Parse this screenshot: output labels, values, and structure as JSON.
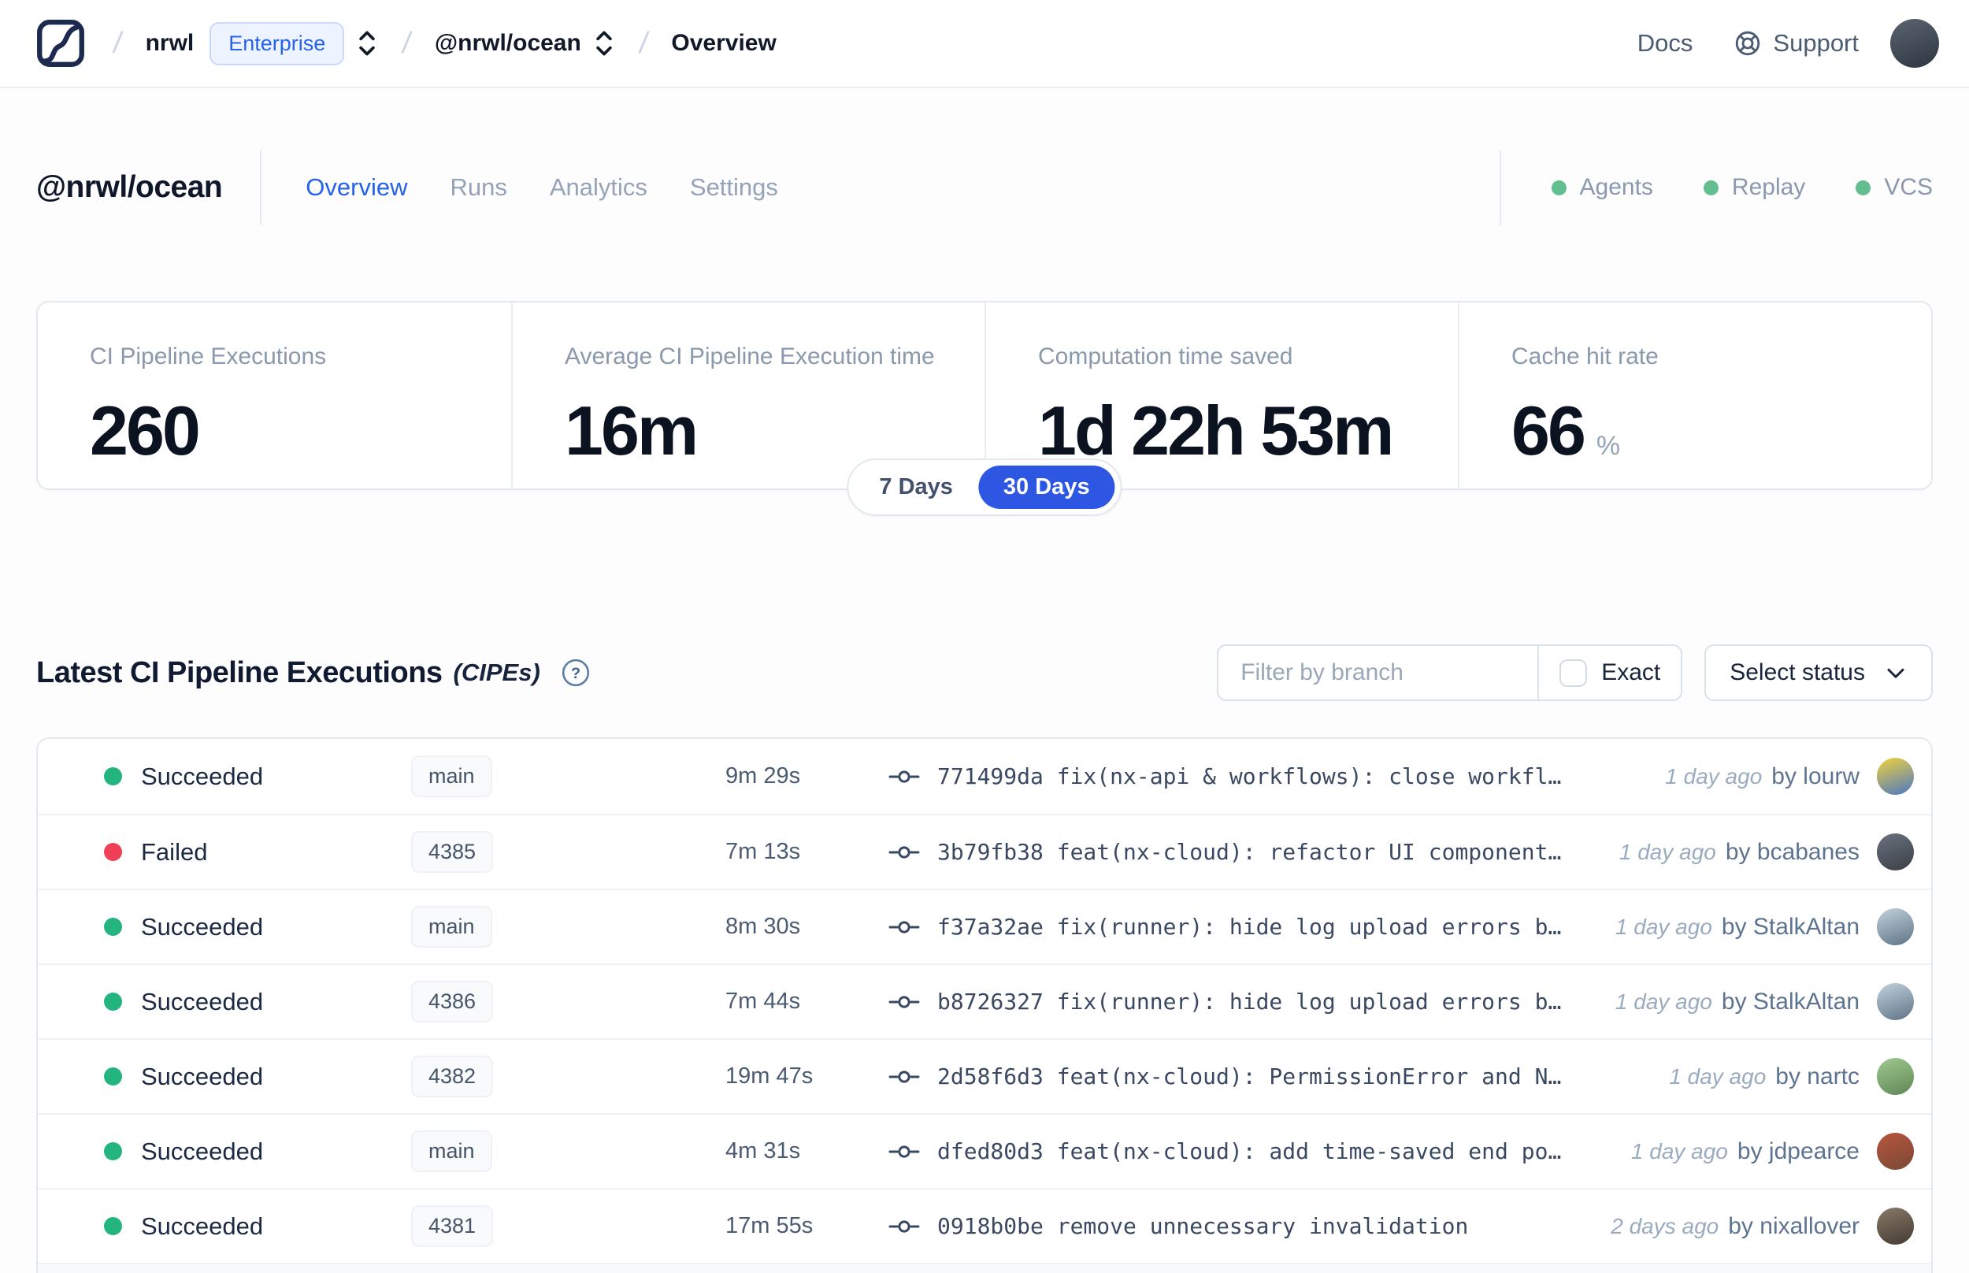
{
  "navbar": {
    "logo": "nx-cloud-logo",
    "breadcrumb": {
      "separator": "/",
      "org": "nrwl",
      "org_badge": "Enterprise",
      "workspace": "@nrwl/ocean",
      "page": "Overview"
    },
    "docs_label": "Docs",
    "support_label": "Support",
    "avatar_colors": [
      "#5a6470",
      "#2e3640"
    ]
  },
  "workspace_header": {
    "title": "@nrwl/ocean",
    "tabs": [
      {
        "label": "Overview",
        "active": true
      },
      {
        "label": "Runs",
        "active": false
      },
      {
        "label": "Analytics",
        "active": false
      },
      {
        "label": "Settings",
        "active": false
      }
    ],
    "status_indicators": [
      {
        "label": "Agents",
        "color": "#62be8e"
      },
      {
        "label": "Replay",
        "color": "#62be8e"
      },
      {
        "label": "VCS",
        "color": "#62be8e"
      }
    ]
  },
  "stats": {
    "cards": [
      {
        "label": "CI Pipeline Executions",
        "value": "260",
        "suffix": ""
      },
      {
        "label": "Average CI Pipeline Execution time",
        "value": "16m",
        "suffix": ""
      },
      {
        "label": "Computation time saved",
        "value": "1d 22h 53m",
        "suffix": ""
      },
      {
        "label": "Cache hit rate",
        "value": "66",
        "suffix": "%"
      }
    ]
  },
  "time_toggle": {
    "accent": "#2d57e2",
    "options": [
      {
        "label": "7 Days",
        "selected": false
      },
      {
        "label": "30 Days",
        "selected": true
      }
    ]
  },
  "cipe": {
    "title": "Latest CI Pipeline Executions",
    "title_suffix": "(CIPEs)",
    "filter": {
      "placeholder": "Filter by branch",
      "exact_label": "Exact",
      "exact_checked": false
    },
    "status_select_label": "Select status",
    "rows": [
      {
        "status": "Succeeded",
        "status_color": "#24b47e",
        "branch": "main",
        "duration": "9m 29s",
        "commit_hash": "771499da",
        "commit_message": "fix(nx-api & workflows): close workfl…",
        "time_ago": "1 day ago",
        "author": "by lourw",
        "avatar_colors": [
          "#f2d23d",
          "#4a77c4"
        ]
      },
      {
        "status": "Failed",
        "status_color": "#ee4056",
        "branch": "4385",
        "duration": "7m 13s",
        "commit_hash": "3b79fb38",
        "commit_message": "feat(nx-cloud): refactor UI component…",
        "time_ago": "1 day ago",
        "author": "by bcabanes",
        "avatar_colors": [
          "#6b7280",
          "#3a3f46"
        ]
      },
      {
        "status": "Succeeded",
        "status_color": "#24b47e",
        "branch": "main",
        "duration": "8m 30s",
        "commit_hash": "f37a32ae",
        "commit_message": "fix(runner): hide log upload errors b…",
        "time_ago": "1 day ago",
        "author": "by StalkAltan",
        "avatar_colors": [
          "#c3d2dc",
          "#5d7486"
        ]
      },
      {
        "status": "Succeeded",
        "status_color": "#24b47e",
        "branch": "4386",
        "duration": "7m 44s",
        "commit_hash": "b8726327",
        "commit_message": "fix(runner): hide log upload errors b…",
        "time_ago": "1 day ago",
        "author": "by StalkAltan",
        "avatar_colors": [
          "#c3d2dc",
          "#5d7486"
        ]
      },
      {
        "status": "Succeeded",
        "status_color": "#24b47e",
        "branch": "4382",
        "duration": "19m 47s",
        "commit_hash": "2d58f6d3",
        "commit_message": "feat(nx-cloud): PermissionError and N…",
        "time_ago": "1 day ago",
        "author": "by nartc",
        "avatar_colors": [
          "#9fc98e",
          "#5f8757"
        ]
      },
      {
        "status": "Succeeded",
        "status_color": "#24b47e",
        "branch": "main",
        "duration": "4m 31s",
        "commit_hash": "dfed80d3",
        "commit_message": "feat(nx-cloud): add time-saved end po…",
        "time_ago": "1 day ago",
        "author": "by jdpearce",
        "avatar_colors": [
          "#b8543f",
          "#7a4a33"
        ]
      },
      {
        "status": "Succeeded",
        "status_color": "#24b47e",
        "branch": "4381",
        "duration": "17m 55s",
        "commit_hash": "0918b0be",
        "commit_message": "remove unnecessary invalidation",
        "time_ago": "2 days ago",
        "author": "by nixallover",
        "avatar_colors": [
          "#8a7a68",
          "#423a33"
        ]
      }
    ]
  }
}
